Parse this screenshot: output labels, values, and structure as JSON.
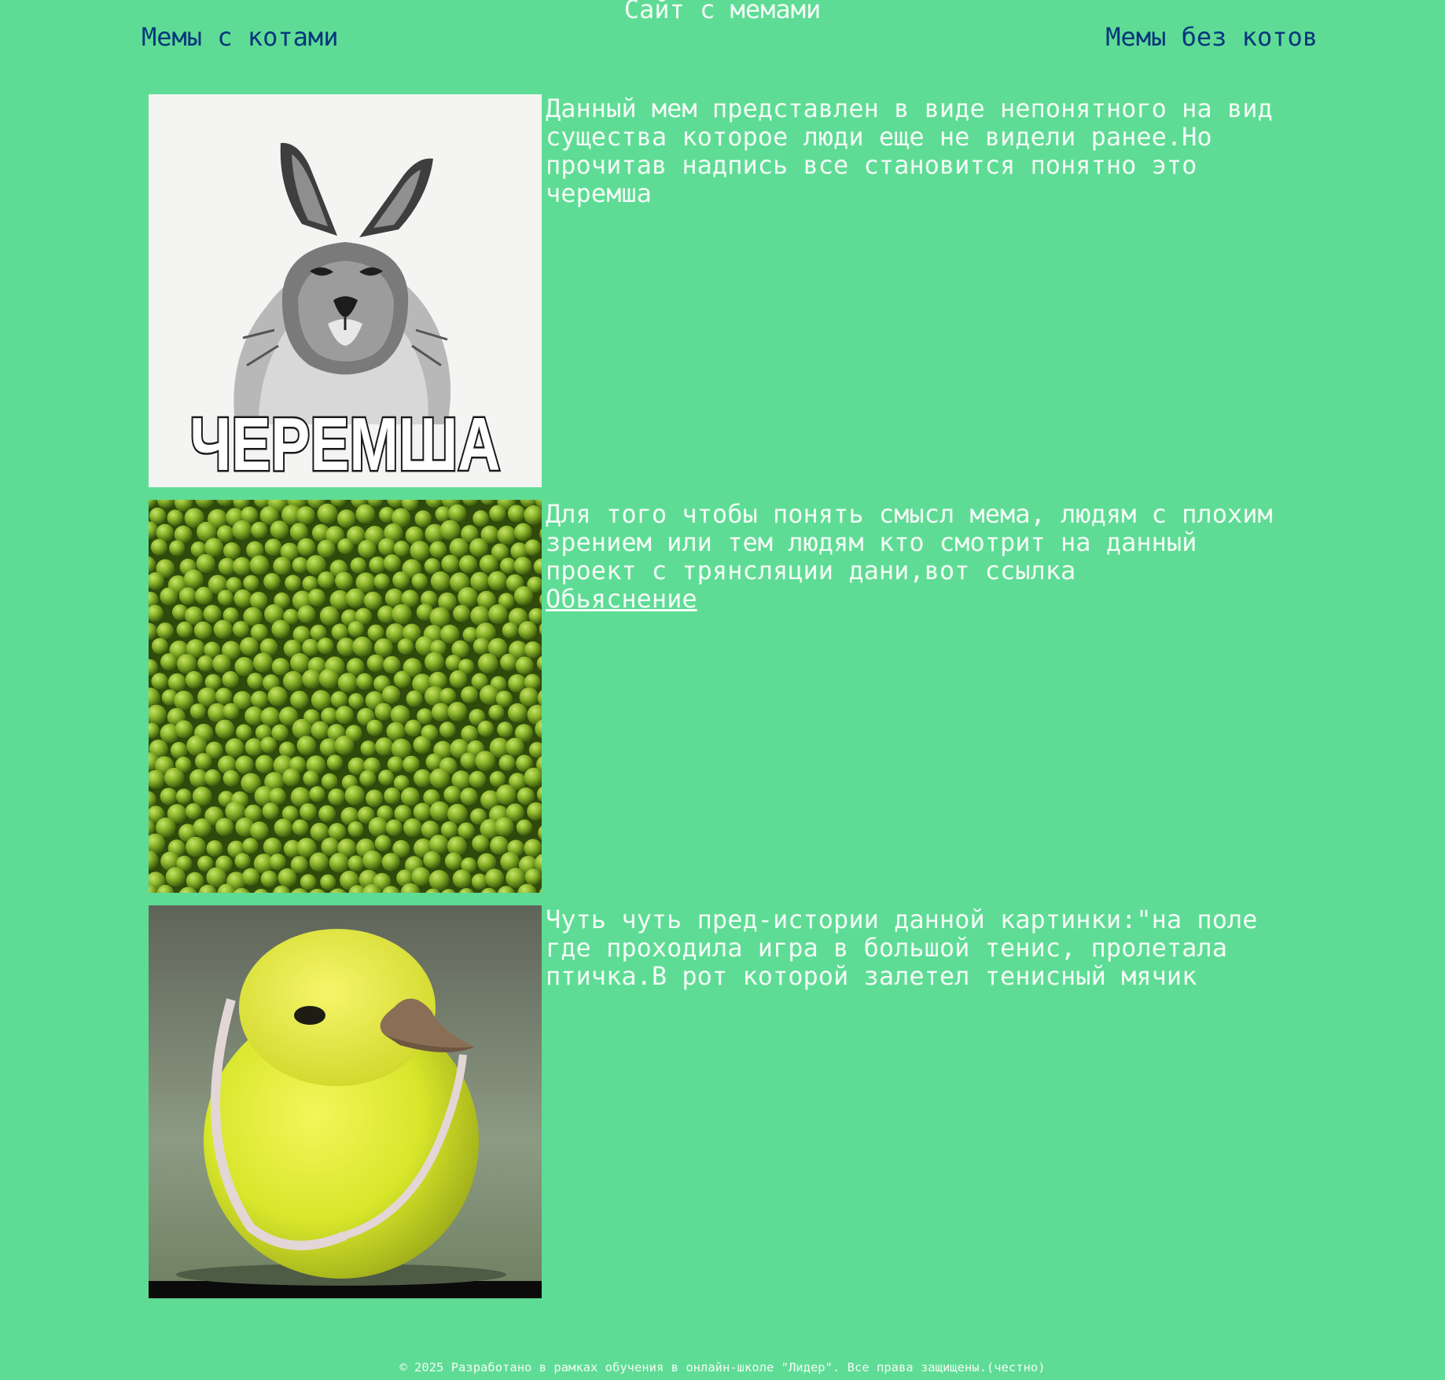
{
  "header": {
    "title": "Сайт с мемами",
    "nav_left": "Мемы с котами",
    "nav_right": "Мемы без котов",
    "link_color": "#07367c",
    "background_color": "#5edc95"
  },
  "memes": [
    {
      "image_label": "ЧЕРЕМША",
      "image_icon": "rabbit-lion-image",
      "text": "Данный мем представлен в виде непонятного на вид существа которое люди еще не видели ранее.Но прочитав надпись все становится понятно это черемша"
    },
    {
      "image_icon": "green-peas-image",
      "text": "Для того чтобы понять смысл мема, людям с плохим зрением или тем людям кто смотрит на данный проект с трянсляции дани,вот ссылка",
      "link_label": "Обьяснение"
    },
    {
      "image_icon": "tennis-ball-chick-image",
      "text": "Чуть чуть пред-истории данной картинки:\"на поле где проходила игра в большой тенис, пролетала птичка.В рот которой залетел тенисный мячик"
    }
  ],
  "footer": {
    "text": "© 2025 Разработано в рамках обучения в онлайн-школе \"Лидер\". Все права защищены.(честно)"
  }
}
